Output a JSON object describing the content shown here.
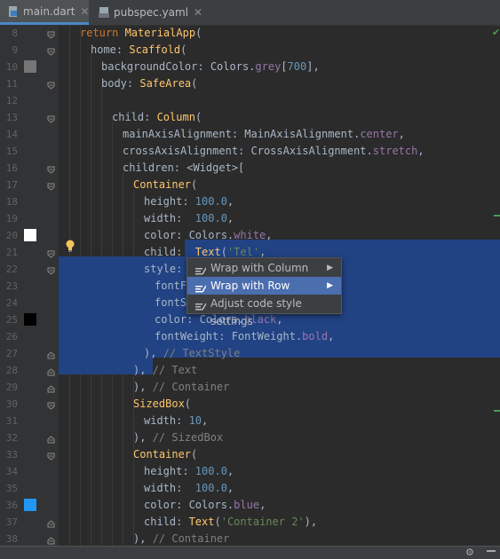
{
  "tabs": [
    {
      "label": "main.dart",
      "icon": "dart-file-icon",
      "active": true
    },
    {
      "label": "pubspec.yaml",
      "icon": "yaml-file-icon",
      "active": false
    }
  ],
  "code_lines": [
    {
      "n": "8",
      "code": [
        [
          "kw",
          "return "
        ],
        [
          "cls",
          "MaterialApp"
        ],
        [
          "p",
          "("
        ]
      ]
    },
    {
      "n": "9",
      "code": [
        [
          "p",
          "home: "
        ],
        [
          "cls",
          "Scaffold"
        ],
        [
          "p",
          "("
        ]
      ]
    },
    {
      "n": "10",
      "code": [
        [
          "p",
          "backgroundColor: Colors."
        ],
        [
          "prop",
          "grey"
        ],
        [
          "p",
          "["
        ],
        [
          "num",
          "700"
        ],
        [
          "p",
          "],"
        ]
      ],
      "swatch": "#757575"
    },
    {
      "n": "11",
      "code": [
        [
          "p",
          "body: "
        ],
        [
          "cls",
          "SafeArea"
        ],
        [
          "p",
          "("
        ]
      ]
    },
    {
      "n": "12",
      "code": []
    },
    {
      "n": "13",
      "code": [
        [
          "p",
          "child: "
        ],
        [
          "cls",
          "Column"
        ],
        [
          "p",
          "("
        ]
      ]
    },
    {
      "n": "14",
      "code": [
        [
          "p",
          "mainAxisAlignment: MainAxisAlignment."
        ],
        [
          "prop",
          "center"
        ],
        [
          "p",
          ","
        ]
      ]
    },
    {
      "n": "15",
      "code": [
        [
          "p",
          "crossAxisAlignment: CrossAxisAlignment."
        ],
        [
          "prop",
          "stretch"
        ],
        [
          "p",
          ","
        ]
      ]
    },
    {
      "n": "16",
      "code": [
        [
          "p",
          "children: <Widget>["
        ]
      ]
    },
    {
      "n": "17",
      "code": [
        [
          "cls",
          "Container"
        ],
        [
          "p",
          "("
        ]
      ]
    },
    {
      "n": "18",
      "code": [
        [
          "p",
          "height: "
        ],
        [
          "num",
          "100.0"
        ],
        [
          "p",
          ","
        ]
      ]
    },
    {
      "n": "19",
      "code": [
        [
          "p",
          "width:  "
        ],
        [
          "num",
          "100.0"
        ],
        [
          "p",
          ","
        ]
      ]
    },
    {
      "n": "20",
      "code": [
        [
          "p",
          "color: Colors."
        ],
        [
          "prop",
          "white"
        ],
        [
          "p",
          ","
        ]
      ],
      "swatch": "#ffffff"
    },
    {
      "n": "21",
      "code": [
        [
          "p",
          "child:  "
        ],
        [
          "cls",
          "Text"
        ],
        [
          "p",
          "("
        ],
        [
          "str",
          "'Tel'"
        ],
        [
          "p",
          ","
        ]
      ]
    },
    {
      "n": "22",
      "code": [
        [
          "p",
          "style: T"
        ]
      ]
    },
    {
      "n": "23",
      "code": [
        [
          "p",
          "fontFa"
        ]
      ]
    },
    {
      "n": "24",
      "code": [
        [
          "p",
          "fontSi"
        ]
      ]
    },
    {
      "n": "25",
      "code": [
        [
          "p",
          "color: Colors."
        ],
        [
          "prop",
          "black"
        ],
        [
          "p",
          ","
        ]
      ],
      "swatch": "#000000"
    },
    {
      "n": "26",
      "code": [
        [
          "p",
          "fontWeight: FontWeight."
        ],
        [
          "prop",
          "bold"
        ],
        [
          "p",
          ","
        ]
      ]
    },
    {
      "n": "27",
      "code": [
        [
          "p",
          "), "
        ],
        [
          "cmt",
          "// TextStyle"
        ]
      ]
    },
    {
      "n": "28",
      "code": [
        [
          "p",
          "), "
        ],
        [
          "cmt",
          "// Text"
        ]
      ]
    },
    {
      "n": "29",
      "code": [
        [
          "p",
          "), "
        ],
        [
          "cmt",
          "// Container"
        ]
      ]
    },
    {
      "n": "30",
      "code": [
        [
          "cls",
          "SizedBox"
        ],
        [
          "p",
          "("
        ]
      ]
    },
    {
      "n": "31",
      "code": [
        [
          "p",
          "width: "
        ],
        [
          "num",
          "10"
        ],
        [
          "p",
          ","
        ]
      ]
    },
    {
      "n": "32",
      "code": [
        [
          "p",
          "), "
        ],
        [
          "cmt",
          "// SizedBox"
        ]
      ]
    },
    {
      "n": "33",
      "code": [
        [
          "cls",
          "Container"
        ],
        [
          "p",
          "("
        ]
      ]
    },
    {
      "n": "34",
      "code": [
        [
          "p",
          "height: "
        ],
        [
          "num",
          "100.0"
        ],
        [
          "p",
          ","
        ]
      ]
    },
    {
      "n": "35",
      "code": [
        [
          "p",
          "width:  "
        ],
        [
          "num",
          "100.0"
        ],
        [
          "p",
          ","
        ]
      ]
    },
    {
      "n": "36",
      "code": [
        [
          "p",
          "color: Colors."
        ],
        [
          "prop",
          "blue"
        ],
        [
          "p",
          ","
        ]
      ],
      "swatch": "#2196f3"
    },
    {
      "n": "37",
      "code": [
        [
          "p",
          "child: "
        ],
        [
          "cls",
          "Text"
        ],
        [
          "p",
          "("
        ],
        [
          "str",
          "'Container 2'"
        ],
        [
          "p",
          "),"
        ]
      ]
    },
    {
      "n": "38",
      "code": [
        [
          "p",
          "), "
        ],
        [
          "cmt",
          "// Container"
        ]
      ]
    }
  ],
  "context_menu": {
    "items": [
      {
        "label": "Wrap with Column",
        "submenu": true,
        "highlighted": false
      },
      {
        "label": "Wrap with Row",
        "submenu": true,
        "highlighted": true
      },
      {
        "label": "Adjust code style settings",
        "submenu": false,
        "highlighted": false
      }
    ]
  },
  "colors": {
    "editor_bg": "#2b2b2b",
    "selection": "#214283",
    "menu_highlight": "#4b6eaf",
    "keyword": "#cc7832",
    "class": "#ffc66d",
    "string": "#6a8759",
    "number": "#6897bb",
    "property": "#9876aa",
    "comment": "#808080"
  }
}
